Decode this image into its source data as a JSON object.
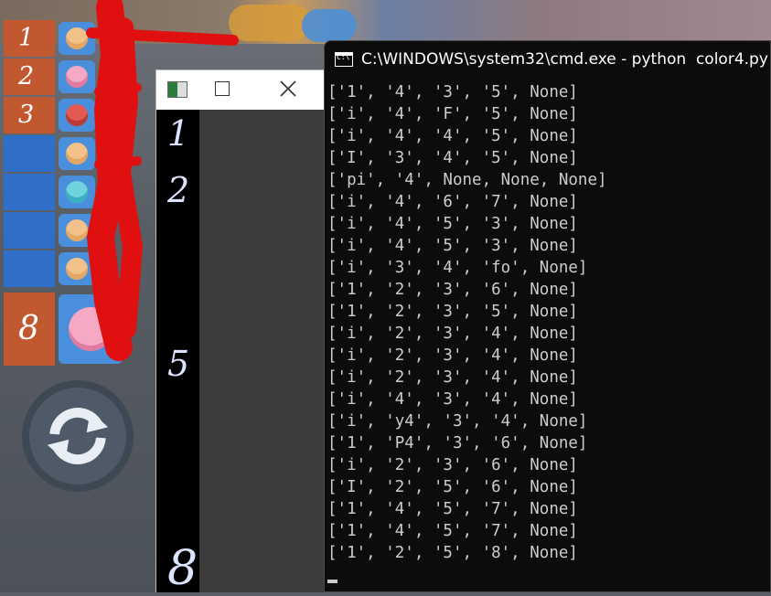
{
  "game": {
    "ranks": [
      {
        "num": "1",
        "color": "orange",
        "face": ""
      },
      {
        "num": "2",
        "color": "orange",
        "face": "pink"
      },
      {
        "num": "3",
        "color": "orange",
        "face": "red"
      },
      {
        "num": "",
        "color": "blue",
        "face": ""
      },
      {
        "num": "",
        "color": "blue",
        "face": "teal"
      },
      {
        "num": "",
        "color": "blue",
        "face": ""
      },
      {
        "num": "",
        "color": "blue",
        "face": ""
      }
    ],
    "last_rank": "8",
    "refresh_icon": "refresh-icon"
  },
  "small_window": {
    "maximize_icon": "maximize-icon",
    "close_icon": "close-icon",
    "slots": [
      "1",
      "2",
      "5",
      "8"
    ]
  },
  "cmd": {
    "title": "C:\\WINDOWS\\system32\\cmd.exe - python  color4.py",
    "icon_text": "C:\\",
    "lines": [
      "['1', '4', '3', '5', None]",
      "['i', '4', 'F', '5', None]",
      "['i', '4', '4', '5', None]",
      "['I', '3', '4', '5', None]",
      "['pi', '4', None, None, None]",
      "['i', '4', '6', '7', None]",
      "['i', '4', '5', '3', None]",
      "['i', '4', '5', '3', None]",
      "['i', '3', '4', 'fo', None]",
      "['1', '2', '3', '6', None]",
      "['1', '2', '3', '5', None]",
      "['i', '2', '3', '4', None]",
      "['i', '2', '3', '4', None]",
      "['i', '2', '3', '4', None]",
      "['i', '4', '3', '4', None]",
      "['i', 'y4', '3', '4', None]",
      "['1', 'P4', '3', '6', None]",
      "['i', '2', '3', '6', None]",
      "['I', '2', '5', '6', None]",
      "['1', '4', '5', '7', None]",
      "['1', '4', '5', '7', None]",
      "['1', '2', '5', '8', None]"
    ]
  },
  "colors": {
    "rank_orange": "#c2582f",
    "rank_blue": "#2f6fc9",
    "console_bg": "#0c0c0c",
    "console_text": "#cccccc",
    "scribble": "#e01010"
  }
}
